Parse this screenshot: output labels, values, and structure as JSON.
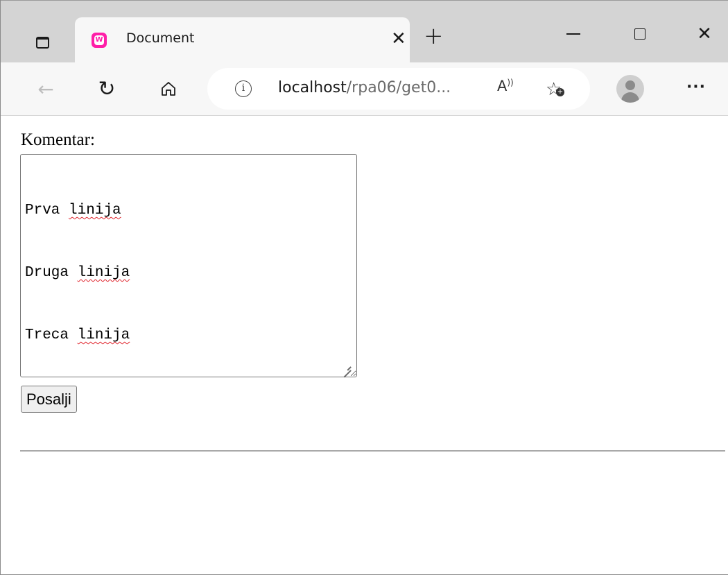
{
  "browser": {
    "tab": {
      "title": "Document",
      "favicon_letter": "W",
      "close_glyph": "✕",
      "favicon_color": "#ff1ea8"
    },
    "new_tab_glyph": "+",
    "window_controls": {
      "close_glyph": "✕"
    },
    "toolbar": {
      "back_glyph": "←",
      "reload_glyph": "↻",
      "home_icon": "home-icon",
      "read_aloud_label": "Aʼₐ",
      "favorites_glyph": "☆",
      "favorites_plus": "+",
      "more_glyph": "···"
    },
    "address_bar": {
      "info_glyph": "i",
      "url_host": "localhost",
      "url_path": "/rpa06/get0..."
    }
  },
  "page": {
    "form": {
      "label": "Komentar:",
      "textarea_lines": [
        {
          "first": "Prva",
          "second": "linija"
        },
        {
          "first": "Druga",
          "second": "linija"
        },
        {
          "first": "Treca",
          "second": "linija"
        }
      ],
      "submit_label": "Posalji"
    }
  }
}
